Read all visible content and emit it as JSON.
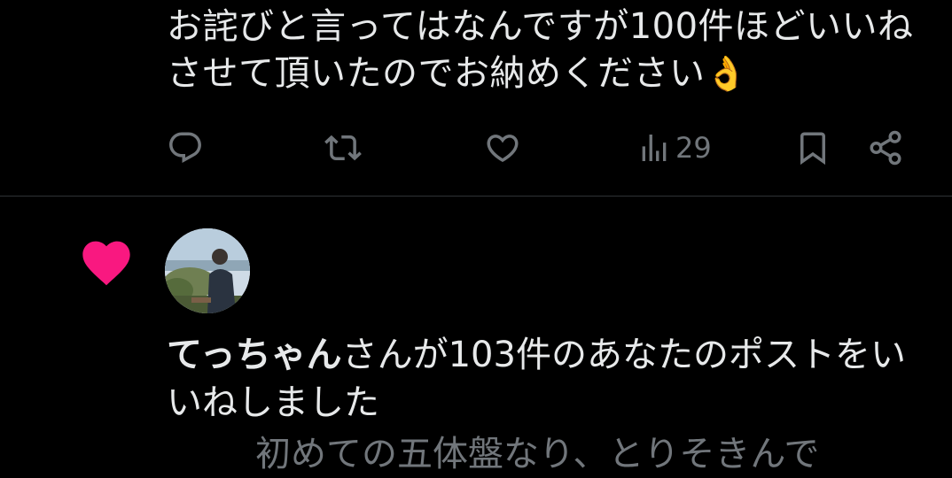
{
  "tweet": {
    "text": "お詫びと言ってはなんですが100件ほどいいねさせて頂いたのでお納めください",
    "emoji": "👌",
    "views": "29"
  },
  "actions": {
    "reply_icon": "reply-icon",
    "retweet_icon": "retweet-icon",
    "like_icon": "heart-outline-icon",
    "views_icon": "views-icon",
    "bookmark_icon": "bookmark-icon",
    "share_icon": "share-icon"
  },
  "notification": {
    "icon": "heart-icon",
    "icon_color": "#f91880",
    "user_name": "てっちゃん",
    "message": "さんが103件のあなたのポストをいいねしました",
    "preview": "初めての五体盤なり、とりそきんで"
  }
}
